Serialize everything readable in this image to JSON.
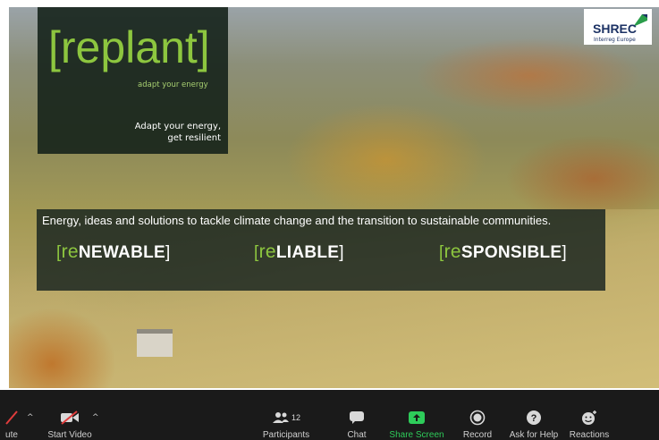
{
  "logo": {
    "open_bracket": "[",
    "word": "replant",
    "close_bracket": "]",
    "subtitle": "adapt your energy",
    "tagline_line1": "Adapt your energy,",
    "tagline_line2": "get resilient"
  },
  "partner_logo": {
    "name": "SHREC",
    "sub": "Interreg Europe"
  },
  "banner": {
    "text": "Energy, ideas and solutions to tackle climate change and the transition to sustainable communities.",
    "pillars": [
      {
        "prefix": "re",
        "rest": "NEWABLE"
      },
      {
        "prefix": "re",
        "rest": "LIABLE"
      },
      {
        "prefix": "re",
        "rest": "SPONSIBLE"
      }
    ]
  },
  "toolbar": {
    "mute_label": "ute",
    "start_video_label": "Start Video",
    "participants_label": "Participants",
    "participants_count": "12",
    "chat_label": "Chat",
    "share_screen_label": "Share Screen",
    "record_label": "Record",
    "help_label": "Ask for Help",
    "reactions_label": "Reactions",
    "caret": "^"
  },
  "colors": {
    "brand_green": "#8dc63f",
    "toolbar_bg": "#1a1a1a",
    "share_green": "#2ecc5a",
    "shrec_navy": "#1c3264"
  }
}
